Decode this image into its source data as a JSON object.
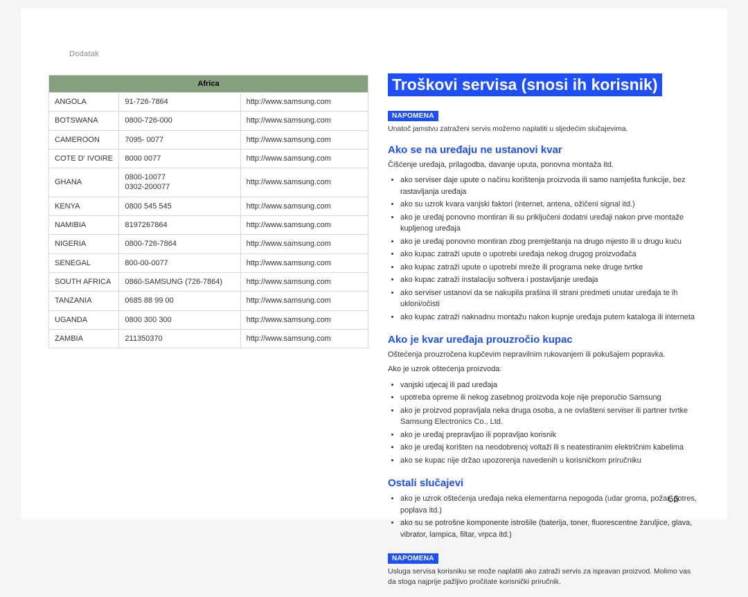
{
  "section_label": "Dodatak",
  "page_number": "66",
  "table": {
    "region_header": "Africa",
    "rows": [
      {
        "country": "ANGOLA",
        "phone": "91-726-7864",
        "url": "http://www.samsung.com"
      },
      {
        "country": "BOTSWANA",
        "phone": "0800-726-000",
        "url": "http://www.samsung.com"
      },
      {
        "country": "CAMEROON",
        "phone": "7095- 0077",
        "url": "http://www.samsung.com"
      },
      {
        "country": "COTE D' IVOIRE",
        "phone": "8000 0077",
        "url": "http://www.samsung.com"
      },
      {
        "country": "GHANA",
        "phone": "0800-10077\n0302-200077",
        "url": "http://www.samsung.com"
      },
      {
        "country": "KENYA",
        "phone": "0800 545 545",
        "url": "http://www.samsung.com"
      },
      {
        "country": "NAMIBIA",
        "phone": "8197267864",
        "url": "http://www.samsung.com"
      },
      {
        "country": "NIGERIA",
        "phone": "0800-726-7864",
        "url": "http://www.samsung.com"
      },
      {
        "country": "SENEGAL",
        "phone": "800-00-0077",
        "url": "http://www.samsung.com"
      },
      {
        "country": "SOUTH AFRICA",
        "phone": "0860-SAMSUNG (726-7864)",
        "url": "http://www.samsung.com"
      },
      {
        "country": "TANZANIA",
        "phone": "0685 88 99 00",
        "url": "http://www.samsung.com"
      },
      {
        "country": "UGANDA",
        "phone": "0800 300 300",
        "url": "http://www.samsung.com"
      },
      {
        "country": "ZAMBIA",
        "phone": "211350370",
        "url": "http://www.samsung.com"
      }
    ]
  },
  "right": {
    "title": "Troškovi servisa (snosi ih korisnik)",
    "note1_badge": "NAPOMENA",
    "note1_text": "Unatoč jamstvu zatraženi servis možemo naplatiti u sljedećim slučajevima.",
    "h1": "Ako se na uređaju ne ustanovi kvar",
    "h1_text": "Čišćenje uređaja, prilagodba, davanje uputa, ponovna montaža itd.",
    "h1_bullets": [
      "ako serviser daje upute o načinu korištenja proizvoda ili samo namješta funkcije, bez rastavljanja uređaja",
      "ako su uzrok kvara vanjski faktori (internet, antena, ožičeni signal itd.)",
      "ako je uređaj ponovno montiran ili su priključeni dodatni uređaji nakon prve montaže kupljenog uređaja",
      "ako je uređaj ponovno montiran zbog premještanja na drugo mjesto ili u drugu kuću",
      "ako kupac zatraži upute o upotrebi uređaja nekog drugog proizvođača",
      "ako kupac zatraži upute o upotrebi mreže ili programa neke druge tvrtke",
      "ako kupac zatraži instalaciju softvera i postavljanje uređaja",
      "ako serviser ustanovi da se nakupila prašina ili strani predmeti unutar uređaja te ih ukloni/očisti",
      "ako kupac zatraži naknadnu montažu nakon kupnje uređaja putem kataloga ili interneta"
    ],
    "h2": "Ako je kvar uređaja prouzročio kupac",
    "h2_text1": "Oštećenja prouzročena kupčevim nepravilnim rukovanjem ili pokušajem popravka.",
    "h2_text2": "Ako je uzrok oštećenja proizvoda:",
    "h2_bullets": [
      "vanjski utjecaj ili pad uređaja",
      "upotreba opreme ili nekog zasebnog proizvoda koje nije preporučio Samsung",
      "ako je proizvod popravljala neka druga osoba, a ne ovlašteni serviser ili partner tvrtke Samsung Electronics Co., Ltd.",
      "ako je uređaj prepravljao ili popravljao korisnik",
      "ako je uređaj korišten na neodobrenoj voltaži ili s neatestiranim električnim kabelima",
      "ako se kupac nije držao upozorenja navedenih u korisničkom priručniku"
    ],
    "h3": "Ostali slučajevi",
    "h3_bullets": [
      "ako je uzrok oštećenja uređaja neka elementarna nepogoda (udar groma, požar, potres, poplava itd.)",
      "ako su se potrošne komponente istrošile (baterija, toner, fluorescentne žaruljice, glava, vibrator, lampica, filtar, vrpca itd.)"
    ],
    "note2_badge": "NAPOMENA",
    "note2_text": "Usluga servisa korisniku se može naplatiti ako zatraži servis za ispravan proizvod. Molimo vas da stoga najprije pažljivo pročitate korisnički priručnik."
  }
}
